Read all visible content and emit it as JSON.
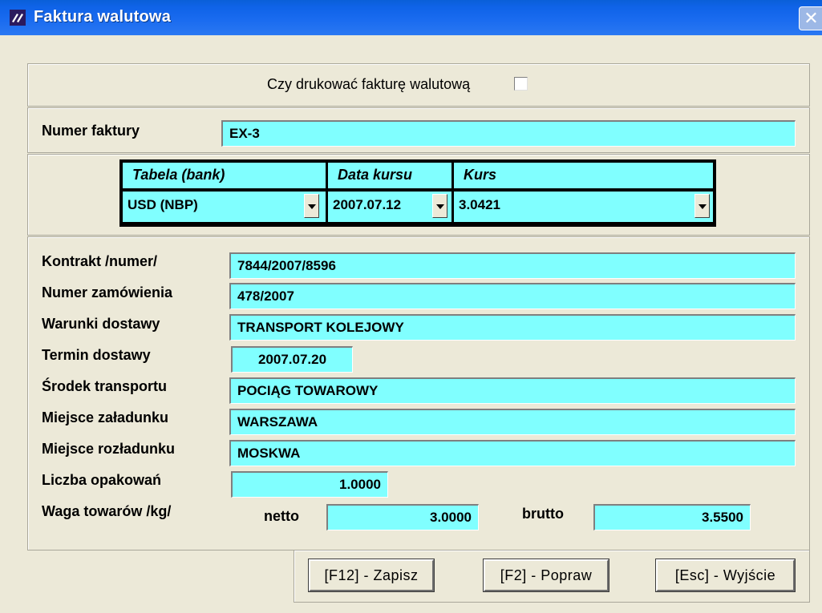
{
  "window": {
    "title": "Faktura walutowa",
    "close_symbol": "✕"
  },
  "print": {
    "label": "Czy drukować fakturę walutową",
    "checked": false
  },
  "invoice": {
    "label": "Numer faktury",
    "value": "EX-3"
  },
  "rates": {
    "headers": [
      "Tabela (bank)",
      "Data kursu",
      "Kurs"
    ],
    "table_value": "USD (NBP)",
    "date_value": "2007.07.12",
    "rate_value": "3.0421"
  },
  "details": {
    "contract": {
      "label": "Kontrakt /numer/",
      "value": "7844/2007/8596"
    },
    "order": {
      "label": "Numer zamówienia",
      "value": "478/2007"
    },
    "terms": {
      "label": "Warunki dostawy",
      "value": "TRANSPORT KOLEJOWY"
    },
    "delivery_date": {
      "label": "Termin dostawy",
      "value": "2007.07.20"
    },
    "transport": {
      "label": "Środek transportu",
      "value": "POCIĄG TOWAROWY"
    },
    "loading": {
      "label": "Miejsce załadunku",
      "value": "WARSZAWA"
    },
    "unloading": {
      "label": "Miejsce rozładunku",
      "value": "MOSKWA"
    },
    "packages": {
      "label": "Liczba opakowań",
      "value": "1.0000"
    },
    "weight": {
      "label": "Waga towarów /kg/",
      "netto_label": "netto",
      "netto_value": "3.0000",
      "brutto_label": "brutto",
      "brutto_value": "3.5500"
    }
  },
  "buttons": {
    "save": "[F12] - Zapisz",
    "edit": "[F2] - Popraw",
    "exit": "[Esc] - Wyjście"
  },
  "colors": {
    "field_bg": "#80ffff",
    "titlebar": "#0f63e8",
    "window_bg": "#ece9d8"
  }
}
